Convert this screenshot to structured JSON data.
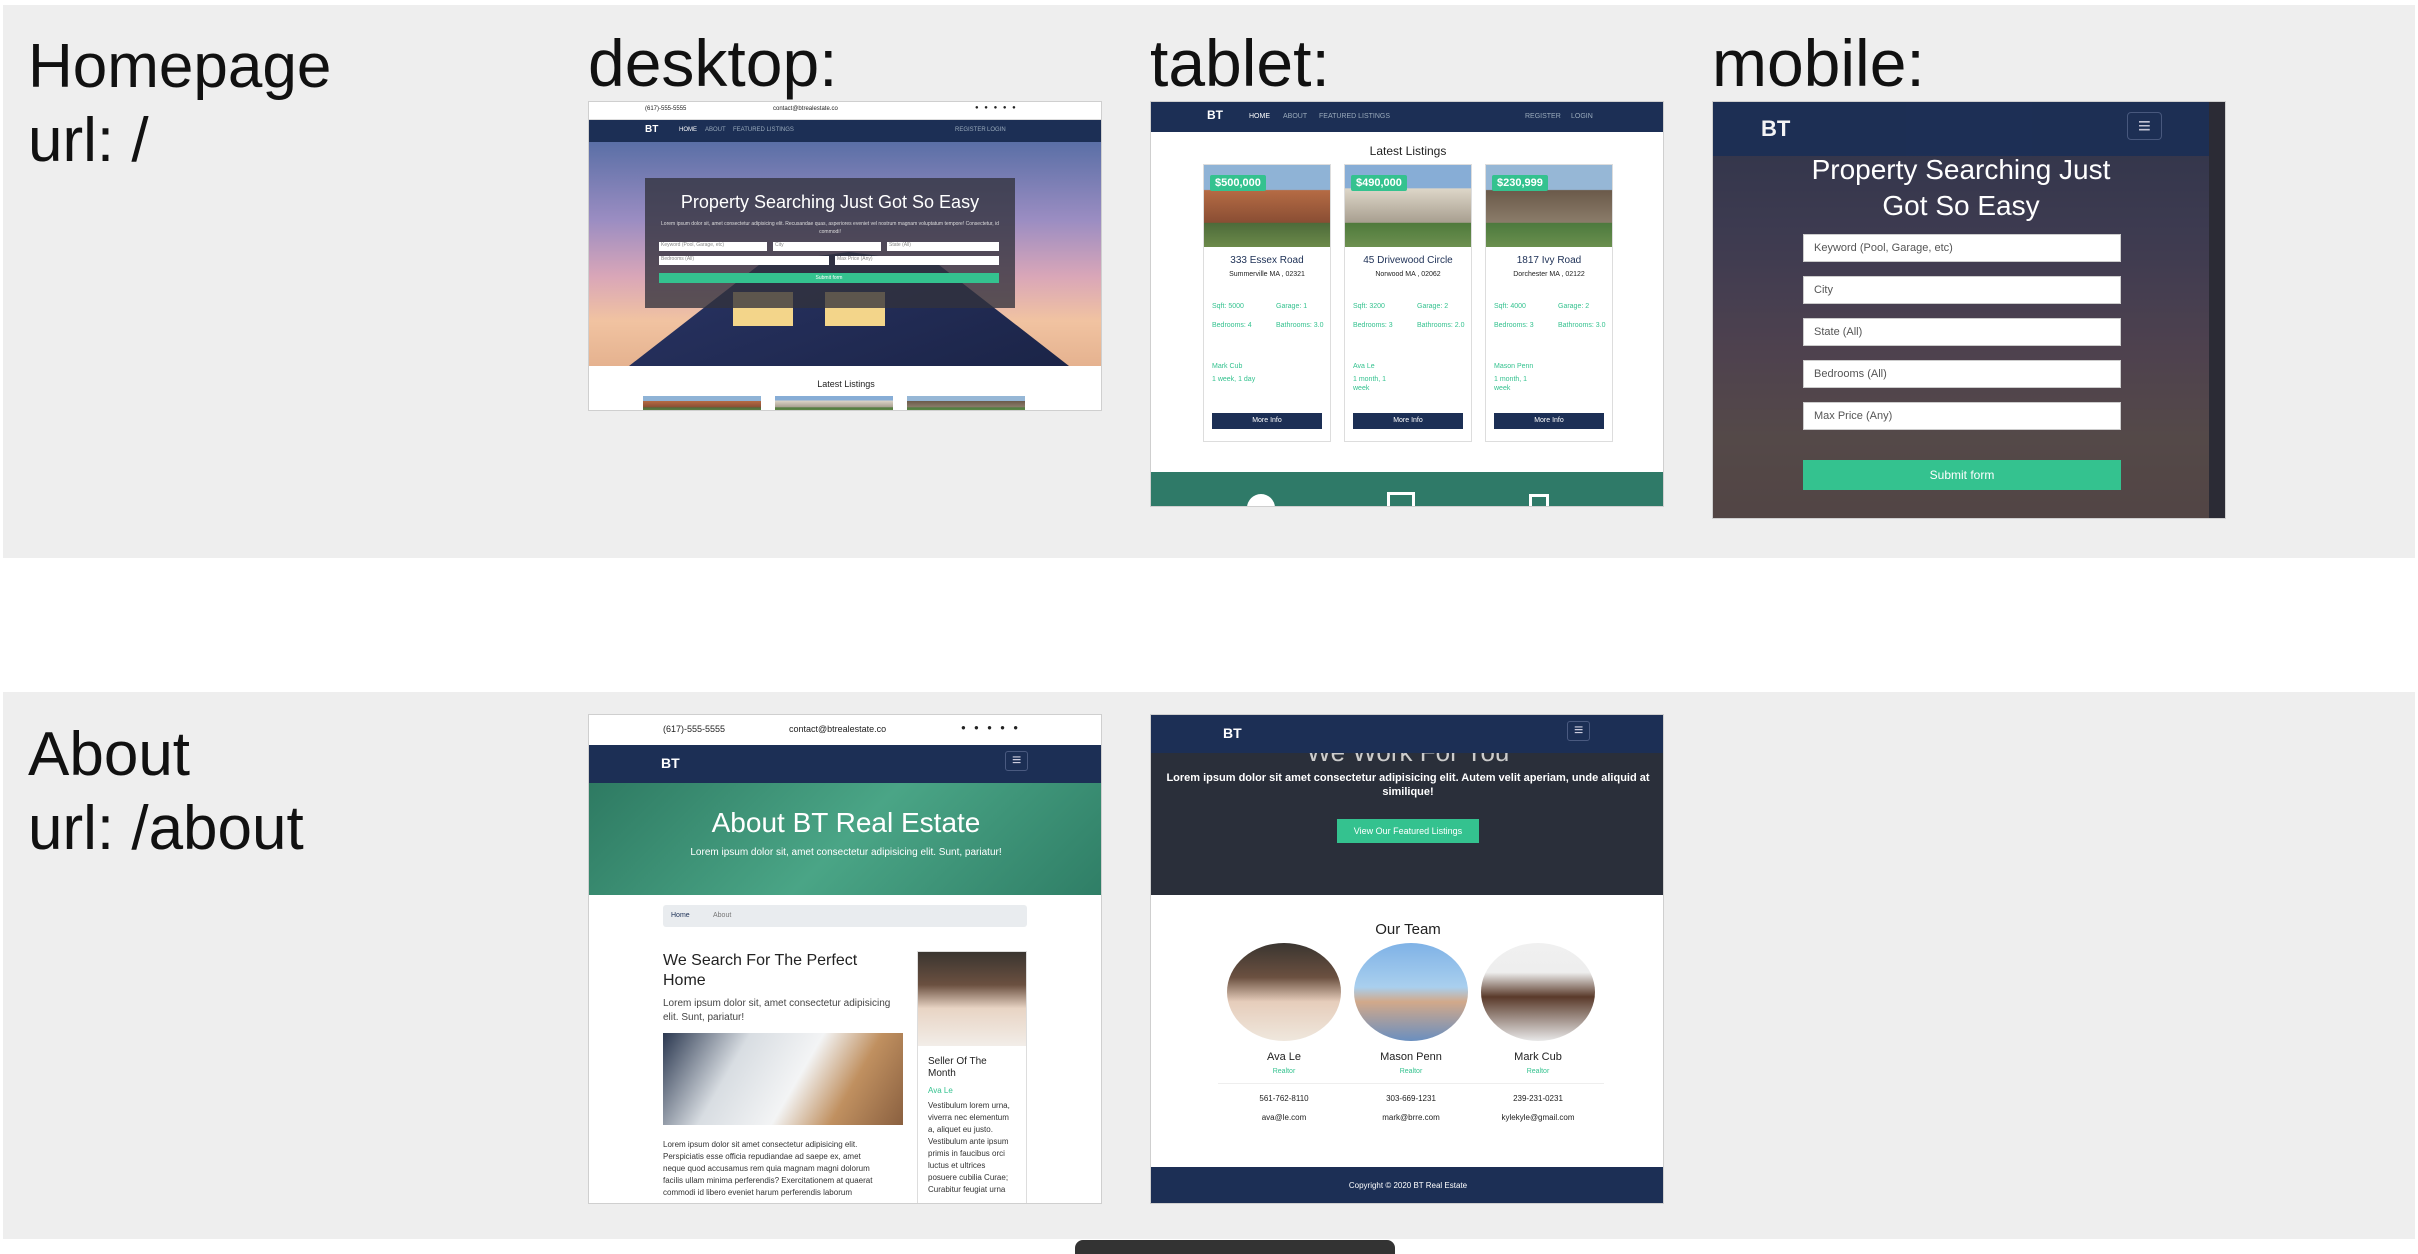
{
  "rows": [
    {
      "title": "Homepage",
      "url": "url: /"
    },
    {
      "title": "About",
      "url": "url: /about"
    }
  ],
  "columns": {
    "desktop": "desktop:",
    "tablet": "tablet:",
    "mobile": "mobile:"
  },
  "site": {
    "phone": "(617)-555-5555",
    "email": "contact@btrealestate.co",
    "logo_text": "BT",
    "nav": [
      "HOME",
      "ABOUT",
      "FEATURED LISTINGS"
    ],
    "register": "REGISTER",
    "login": "LOGIN"
  },
  "home": {
    "hero_title": "Property Searching Just Got So Easy",
    "hero_title_line1": "Property Searching Just",
    "hero_title_line2": "Got So Easy",
    "hero_text": "Lorem ipsum dolor sit, amet consectetur adipisicing elit. Recusandae quas, asperiores eveniet vel nostrum magnam voluptatum tempore! Consectetur, id commodi!",
    "fields": {
      "keyword": "Keyword (Pool, Garage, etc)",
      "city": "City",
      "state": "State (All)",
      "bedrooms": "Bedrooms (All)",
      "max_price": "Max Price (Any)"
    },
    "submit": "Submit form",
    "latest_listings": "Latest Listings",
    "listings": [
      {
        "price": "$500,000",
        "title": "333 Essex Road",
        "location": "Summerville MA , 02321",
        "sqft": "Sqft: 5000",
        "garage": "Garage: 1",
        "bedrooms": "Bedrooms: 4",
        "bathrooms": "Bathrooms: 3.0",
        "realtor": "Mark Cub",
        "age": "1 week, 1 day",
        "more": "More Info"
      },
      {
        "price": "$490,000",
        "title": "45 Drivewood Circle",
        "location": "Norwood MA , 02062",
        "sqft": "Sqft: 3200",
        "garage": "Garage: 2",
        "bedrooms": "Bedrooms: 3",
        "bathrooms": "Bathrooms: 2.0",
        "realtor": "Ava Le",
        "age": "1 month, 1 week",
        "more": "More Info"
      },
      {
        "price": "$230,999",
        "title": "1817 Ivy Road",
        "location": "Dorchester MA , 02122",
        "sqft": "Sqft: 4000",
        "garage": "Garage: 2",
        "bedrooms": "Bedrooms: 3",
        "bathrooms": "Bathrooms: 3.0",
        "realtor": "Mason Penn",
        "age": "1 month, 1 week",
        "more": "More Info"
      }
    ]
  },
  "about": {
    "hero_title": "About BT Real Estate",
    "hero_text": "Lorem ipsum dolor sit, amet consectetur adipisicing elit. Sunt, pariatur!",
    "breadcrumb_home": "Home",
    "breadcrumb_current": "About",
    "heading_line1": "We Search For The Perfect",
    "heading_line2": "Home",
    "lead_line1": "Lorem ipsum dolor sit, amet consectetur adipisicing",
    "lead_line2": "elit. Sunt, pariatur!",
    "body_lines": [
      "Lorem ipsum dolor sit amet consectetur adipisicing elit.",
      "Perspiciatis esse officia repudiandae ad saepe ex, amet",
      "neque quod accusamus rem quia magnam magni dolorum",
      "facilis ullam minima perferendis? Exercitationem at quaerat",
      "commodi id libero eveniet harum perferendis laborum"
    ],
    "seller_title_line1": "Seller Of The",
    "seller_title_line2": "Month",
    "seller_name": "Ava Le",
    "seller_lines": [
      "Vestibulum lorem urna,",
      "viverra nec elementum",
      "a, aliquet eu justo.",
      "Vestibulum ante ipsum",
      "primis in faucibus orci",
      "luctus et ultrices",
      "posuere cubilia Curae;",
      "Curabitur feugiat urna"
    ],
    "work_title": "We Work For You",
    "work_text_line1": "Lorem ipsum dolor sit amet consectetur adipisicing elit. Autem velit aperiam, unde aliquid at",
    "work_text_line2": "similique!",
    "work_button": "View Our Featured Listings",
    "team_title": "Our Team",
    "team": [
      {
        "name": "Ava Le",
        "role": "Realtor",
        "phone": "561-762-8110",
        "email": "ava@le.com"
      },
      {
        "name": "Mason Penn",
        "role": "Realtor",
        "phone": "303-669-1231",
        "email": "mark@brre.com"
      },
      {
        "name": "Mark Cub",
        "role": "Realtor",
        "phone": "239-231-0231",
        "email": "kylekyle@gmail.com"
      }
    ],
    "copyright": "Copyright © 2020 BT Real Estate"
  },
  "colors": {
    "navy": "#1c2f55",
    "accent": "#34c28f",
    "band": "#eeeeee"
  }
}
